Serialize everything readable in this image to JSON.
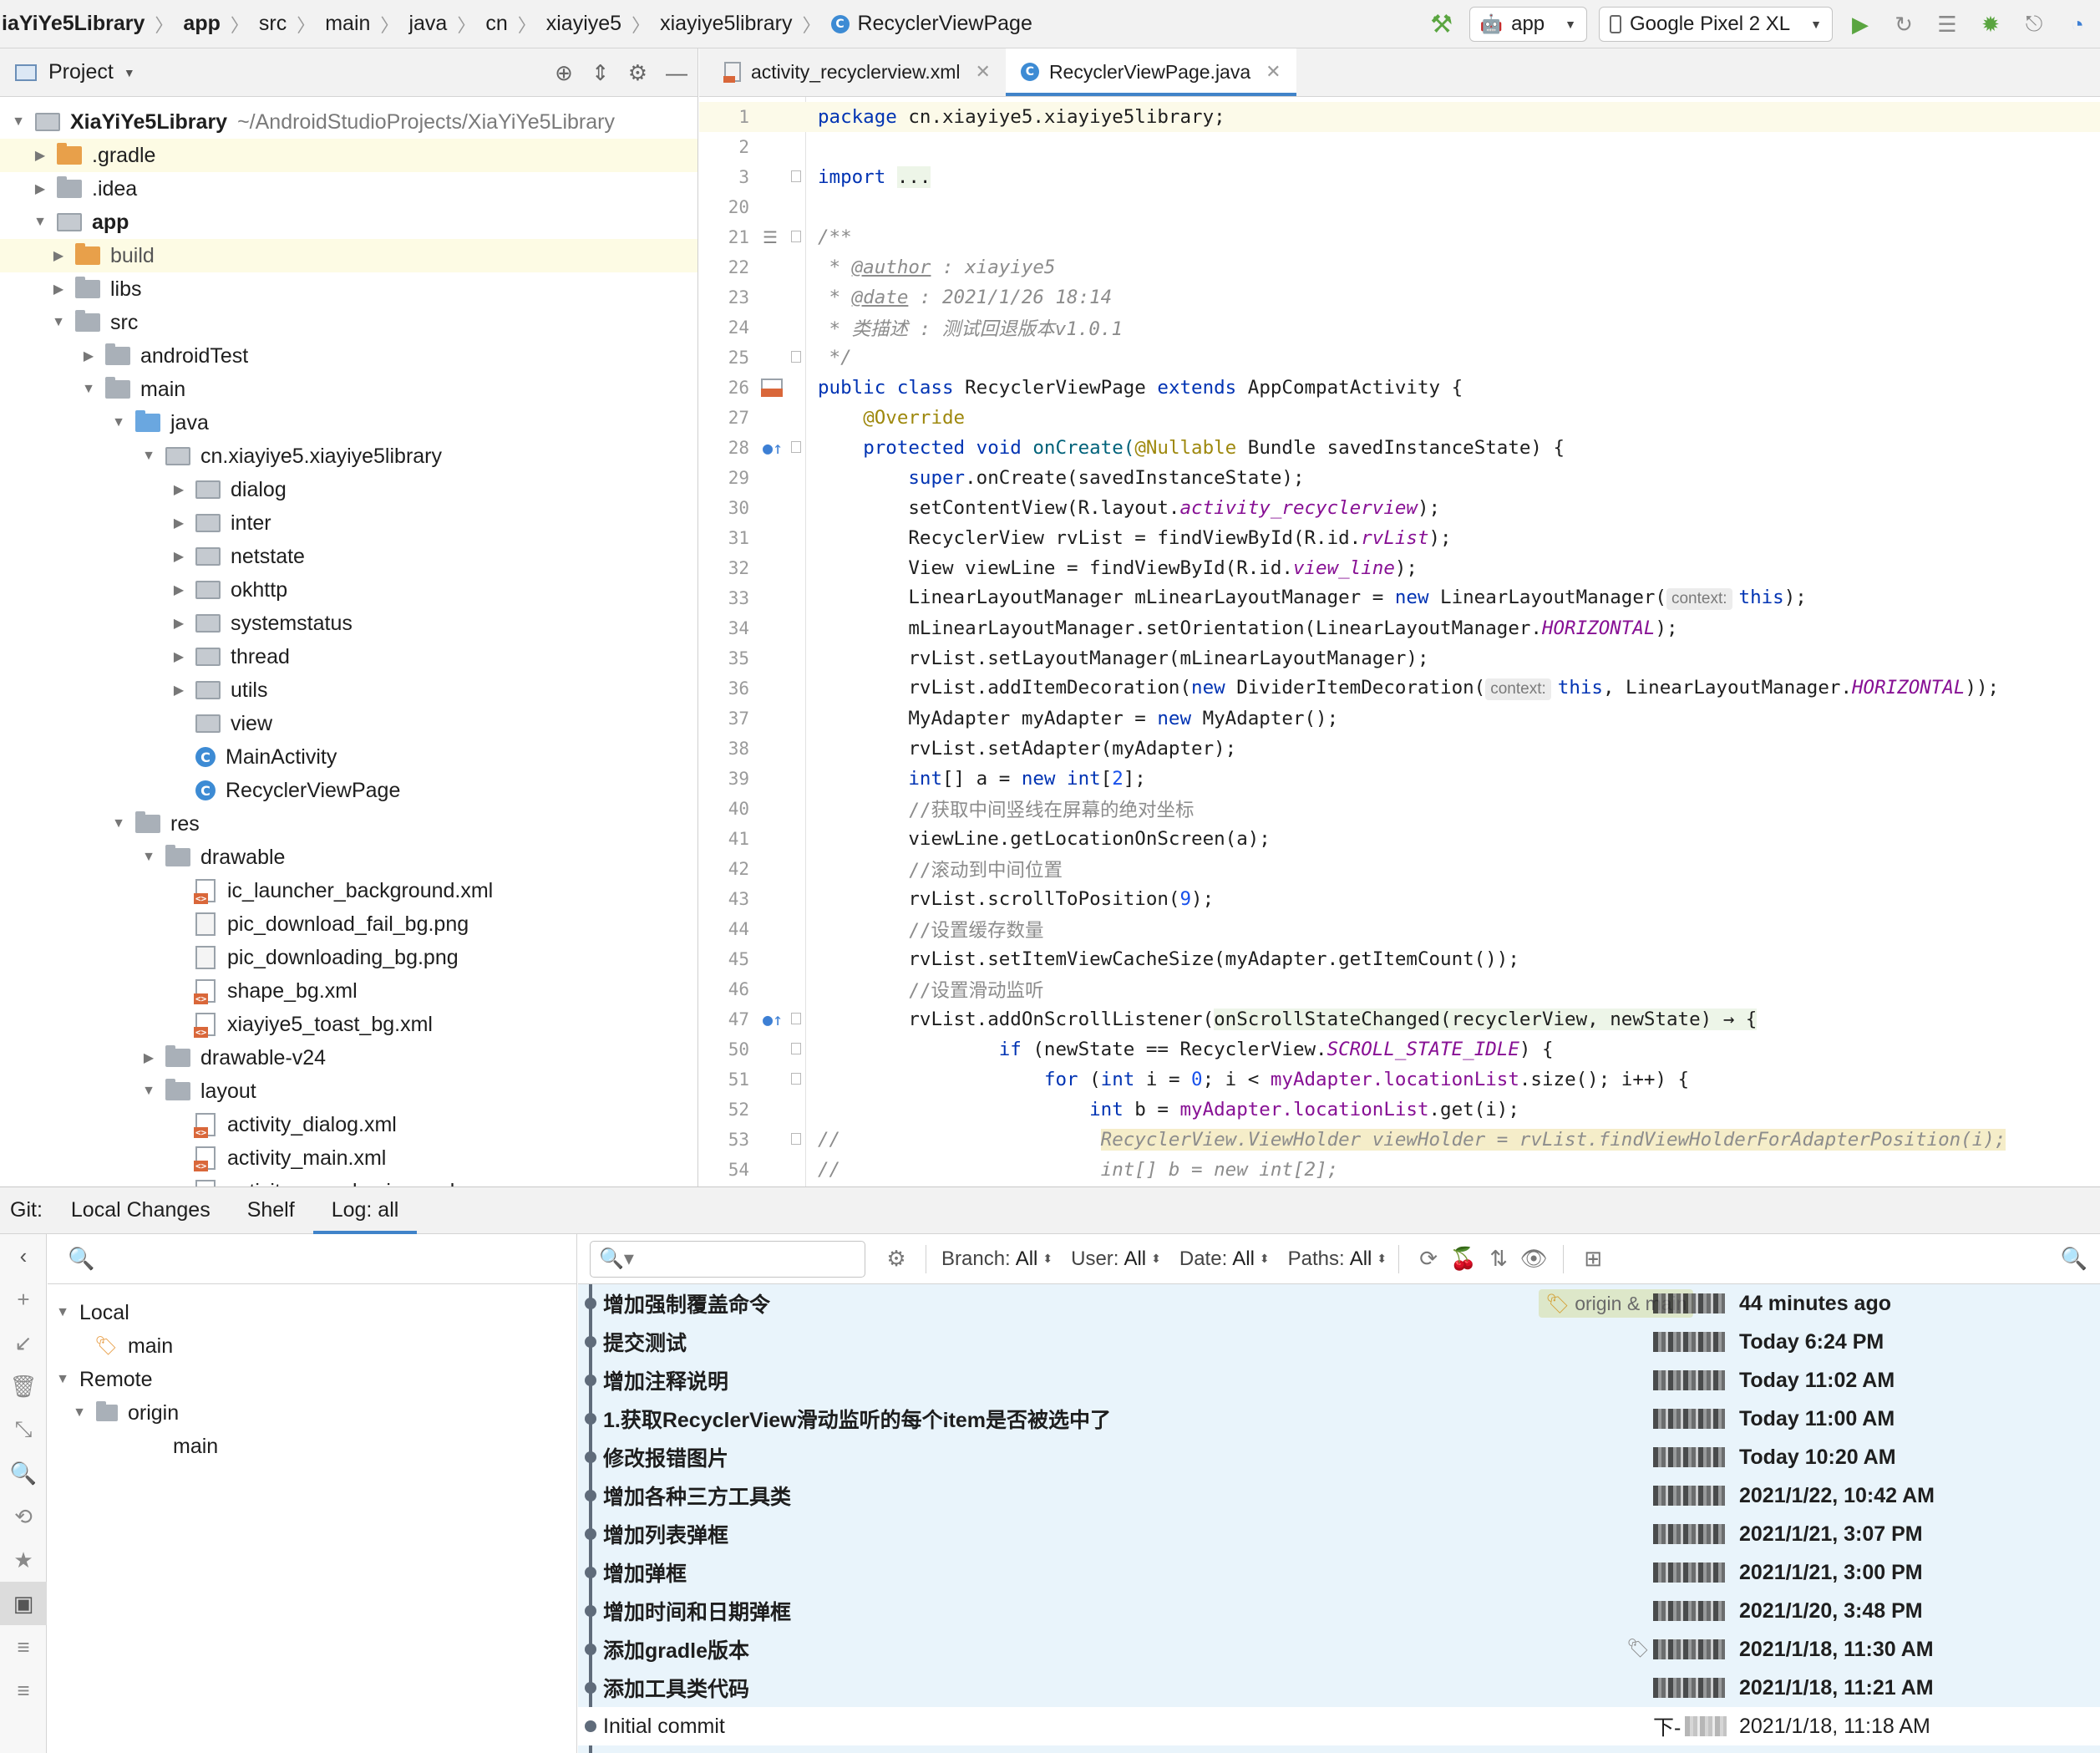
{
  "breadcrumbs": [
    "iaYiYe5Library",
    "app",
    "src",
    "main",
    "java",
    "cn",
    "xiayiye5",
    "xiayiye5library",
    "RecyclerViewPage"
  ],
  "run_config": {
    "module": "app",
    "device": "Google Pixel 2 XL"
  },
  "project_panel": {
    "title": "Project",
    "tree": [
      {
        "label": "XiaYiYe5Library",
        "path": "~/AndroidStudioProjects/XiaYiYe5Library"
      },
      {
        "label": ".gradle"
      },
      {
        "label": ".idea"
      },
      {
        "label": "app"
      },
      {
        "label": "build"
      },
      {
        "label": "libs"
      },
      {
        "label": "src"
      },
      {
        "label": "androidTest"
      },
      {
        "label": "main"
      },
      {
        "label": "java"
      },
      {
        "label": "cn.xiayiye5.xiayiye5library"
      },
      {
        "label": "dialog"
      },
      {
        "label": "inter"
      },
      {
        "label": "netstate"
      },
      {
        "label": "okhttp"
      },
      {
        "label": "systemstatus"
      },
      {
        "label": "thread"
      },
      {
        "label": "utils"
      },
      {
        "label": "view"
      },
      {
        "label": "MainActivity"
      },
      {
        "label": "RecyclerViewPage"
      },
      {
        "label": "res"
      },
      {
        "label": "drawable"
      },
      {
        "label": "ic_launcher_background.xml"
      },
      {
        "label": "pic_download_fail_bg.png"
      },
      {
        "label": "pic_downloading_bg.png"
      },
      {
        "label": "shape_bg.xml"
      },
      {
        "label": "xiayiye5_toast_bg.xml"
      },
      {
        "label": "drawable-v24"
      },
      {
        "label": "layout"
      },
      {
        "label": "activity_dialog.xml"
      },
      {
        "label": "activity_main.xml"
      },
      {
        "label": "activity_recyclerview.xml"
      }
    ]
  },
  "editor": {
    "tabs": [
      {
        "label": "activity_recyclerview.xml"
      },
      {
        "label": "RecyclerViewPage.java"
      }
    ],
    "line_numbers": [
      "1",
      "2",
      "3",
      "20",
      "21",
      "22",
      "23",
      "24",
      "25",
      "26",
      "27",
      "28",
      "29",
      "30",
      "31",
      "32",
      "33",
      "34",
      "35",
      "36",
      "37",
      "38",
      "39",
      "40",
      "41",
      "42",
      "43",
      "44",
      "45",
      "46",
      "47",
      "50",
      "51",
      "52",
      "53",
      "54"
    ],
    "code": {
      "l1_kw": "package",
      "l1_rest": " cn.xiayiye5.xiayiye5library;",
      "l3_kw": "import",
      "l3_rest": "...",
      "l21": "/**",
      "l22_a": " * ",
      "l22_tag": "@author",
      "l22_b": " : xiayiye5",
      "l23_a": " * ",
      "l23_tag": "@date",
      "l23_b": " : 2021/1/26 18:14",
      "l24": " * 类描述 : 测试回退版本v1.0.1",
      "l25": " */",
      "l26_kw1": "public class",
      "l26_mid": " RecyclerViewPage ",
      "l26_kw2": "extends",
      "l26_rest": " AppCompatActivity {",
      "l27": "@Override",
      "l28_kw": "protected void",
      "l28_a": " onCreate(",
      "l28_ann": "@Nullable",
      "l28_b": " Bundle savedInstanceState) {",
      "l29_kw": "super",
      "l29_rest": ".onCreate(savedInstanceState);",
      "l30_a": "setContentView(R.layout.",
      "l30_f": "activity_recyclerview",
      "l30_b": ");",
      "l31_a": "RecyclerView rvList = findViewById(R.id.",
      "l31_f": "rvList",
      "l31_b": ");",
      "l32_a": "View viewLine = findViewById(R.id.",
      "l32_f": "view_line",
      "l32_b": ");",
      "l33_a": "LinearLayoutManager mLinearLayoutManager = ",
      "l33_kw": "new",
      "l33_b": " LinearLayoutManager(",
      "l33_hint": "context:",
      "l33_kw2": "this",
      "l33_c": ");",
      "l34_a": "mLinearLayoutManager.setOrientation(LinearLayoutManager.",
      "l34_f": "HORIZONTAL",
      "l34_b": ");",
      "l35": "rvList.setLayoutManager(mLinearLayoutManager);",
      "l36_a": "rvList.addItemDecoration(",
      "l36_kw": "new",
      "l36_b": " DividerItemDecoration(",
      "l36_hint": "context:",
      "l36_kw2": "this",
      "l36_c": ", LinearLayoutManager.",
      "l36_f": "HORIZONTAL",
      "l36_d": "));",
      "l37_a": "MyAdapter myAdapter = ",
      "l37_kw": "new",
      "l37_b": " MyAdapter();",
      "l38": "rvList.setAdapter(myAdapter);",
      "l39_kw": "int",
      "l39_a": "[] a = ",
      "l39_kw2": "new",
      "l39_kw3": " int",
      "l39_b": "[",
      "l39_num": "2",
      "l39_c": "];",
      "l40": "//获取中间竖线在屏幕的绝对坐标",
      "l41": "viewLine.getLocationOnScreen(a);",
      "l42": "//滚动到中间位置",
      "l43_a": "rvList.scrollToPosition(",
      "l43_num": "9",
      "l43_b": ");",
      "l44": "//设置缓存数量",
      "l45": "rvList.setItemViewCacheSize(myAdapter.getItemCount());",
      "l46": "//设置滑动监听",
      "l47_a": "rvList.addOnScrollListener(",
      "l47_hl": "onScrollStateChanged(recyclerView, newState) → {",
      "l50_kw": "if",
      "l50_a": " (newState == RecyclerView.",
      "l50_f": "SCROLL_STATE_IDLE",
      "l50_b": ") {",
      "l51_kw": "for",
      "l51_a": " (",
      "l51_kw2": "int",
      "l51_b": " i = ",
      "l51_num": "0",
      "l51_c": "; i < ",
      "l51_f": "myAdapter.locationList",
      "l51_d": ".size(); i++) {",
      "l52_kw": "int",
      "l52_a": " b = ",
      "l52_f": "myAdapter.locationList",
      "l52_b": ".get(i);",
      "l53_a": "//",
      "l53_hl": "RecyclerView.ViewHolder viewHolder = rvList.findViewHolderForAdapterPosition(i);",
      "l54_a": "//",
      "l54_b": "int[] b = new int[2];"
    }
  },
  "git": {
    "label": "Git:",
    "tabs": [
      "Local Changes",
      "Shelf",
      "Log: all"
    ],
    "branches": {
      "local_label": "Local",
      "local_branch": "main",
      "remote_label": "Remote",
      "remote_name": "origin",
      "remote_branch": "main"
    },
    "filters": [
      {
        "name": "Branch:",
        "value": "All"
      },
      {
        "name": "User:",
        "value": "All"
      },
      {
        "name": "Date:",
        "value": "All"
      },
      {
        "name": "Paths:",
        "value": "All"
      }
    ],
    "head_refs": "origin & main",
    "commits": [
      {
        "message": "增加强制覆盖命令",
        "date": "44 minutes ago"
      },
      {
        "message": "提交测试",
        "date": "Today 6:24 PM"
      },
      {
        "message": "增加注释说明",
        "date": "Today 11:02 AM"
      },
      {
        "message": "1.获取RecyclerView滑动监听的每个item是否被选中了",
        "date": "Today 11:00 AM"
      },
      {
        "message": "修改报错图片",
        "date": "Today 10:20 AM"
      },
      {
        "message": "增加各种三方工具类",
        "date": "2021/1/22, 10:42 AM"
      },
      {
        "message": "增加列表弹框",
        "date": "2021/1/21, 3:07 PM"
      },
      {
        "message": "增加弹框",
        "date": "2021/1/21, 3:00 PM"
      },
      {
        "message": "增加时间和日期弹框",
        "date": "2021/1/20, 3:48 PM"
      },
      {
        "message": "添加gradle版本",
        "date": "2021/1/18, 11:30 AM"
      },
      {
        "message": "添加工具类代码",
        "date": "2021/1/18, 11:21 AM"
      },
      {
        "message": "Initial commit",
        "date": "2021/1/18, 11:18 AM"
      }
    ],
    "last_author_text": "下-"
  },
  "colors": {
    "accent": "#4083c9",
    "keyword": "#0033b3",
    "comment": "#8c8c8c",
    "field": "#871094",
    "annotation": "#9e880d",
    "number": "#1750eb",
    "log_bg": "#e9f4fb"
  },
  "icons": [
    "hammer-icon",
    "android-icon",
    "device-icon",
    "run-icon",
    "rerun-icon",
    "logcat-icon",
    "debug-icon",
    "attach-debugger-icon",
    "profiler-icon",
    "locate-icon",
    "collapse-icon",
    "gear-icon",
    "minimize-icon",
    "search-icon",
    "refresh-icon",
    "cherry-pick-icon",
    "sort-icon",
    "eye-icon",
    "new-tab-icon",
    "tag-icon"
  ]
}
